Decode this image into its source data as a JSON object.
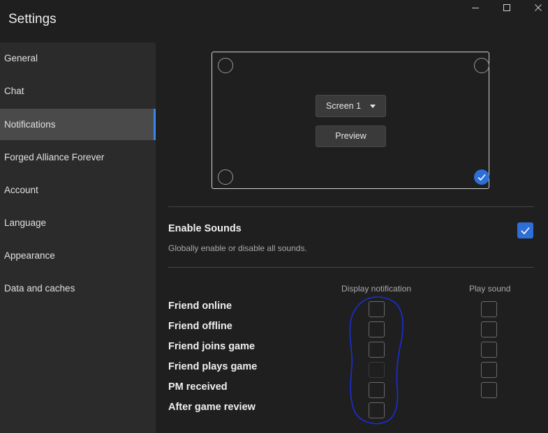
{
  "window": {
    "title": "Settings",
    "controls": [
      {
        "name": "minimize-icon"
      },
      {
        "name": "maximize-icon"
      },
      {
        "name": "close-icon"
      }
    ]
  },
  "sidebar": {
    "items": [
      {
        "label": "General"
      },
      {
        "label": "Chat"
      },
      {
        "label": "Notifications",
        "active": true
      },
      {
        "label": "Forged Alliance Forever"
      },
      {
        "label": "Account"
      },
      {
        "label": "Language"
      },
      {
        "label": "Appearance"
      },
      {
        "label": "Data and caches"
      }
    ]
  },
  "position_picker": {
    "selected_corner": "bottom-right",
    "screen_select_value": "Screen 1",
    "preview_label": "Preview"
  },
  "sounds": {
    "title": "Enable Sounds",
    "description": "Globally enable or disable all sounds.",
    "enabled": true
  },
  "notifications_table": {
    "columns": [
      "Display notification",
      "Play sound"
    ],
    "rows": [
      {
        "label": "Friend online",
        "display": false,
        "sound": false
      },
      {
        "label": "Friend offline",
        "display": false,
        "sound": false
      },
      {
        "label": "Friend joins game",
        "display": false,
        "sound": false
      },
      {
        "label": "Friend plays game",
        "display": false,
        "display_disabled": true,
        "sound": false
      },
      {
        "label": "PM received",
        "display": false,
        "sound": false
      },
      {
        "label": "After game review",
        "display": false,
        "sound": null
      }
    ]
  },
  "colors": {
    "accent": "#2d6fd6",
    "annotation_ink": "#1a2fd8",
    "sidebar_bg": "#2b2b2b",
    "content_bg": "#1f1f1f"
  }
}
